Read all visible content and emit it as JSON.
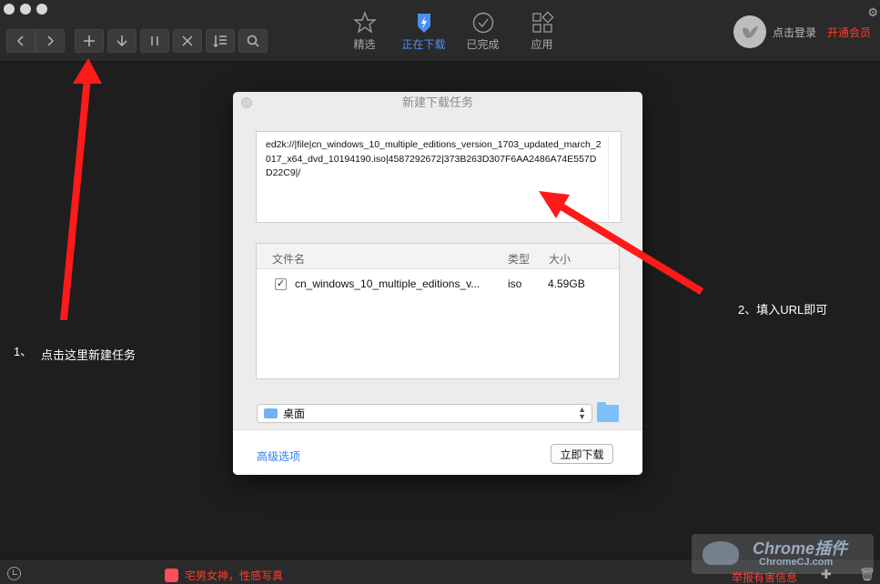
{
  "toolbar": {
    "tabs": [
      {
        "label": "精选",
        "icon": "star-icon"
      },
      {
        "label": "正在下载",
        "icon": "download-bolt-icon",
        "active": true
      },
      {
        "label": "已完成",
        "icon": "check-circle-icon"
      },
      {
        "label": "应用",
        "icon": "apps-icon"
      }
    ],
    "login": "点击登录",
    "vip": "开通会员"
  },
  "annotations": {
    "step1_num": "1、",
    "step1_text": "点击这里新建任务",
    "step2_text": "2、填入URL即可"
  },
  "dialog": {
    "title": "新建下载任务",
    "url_value": "ed2k://|file|cn_windows_10_multiple_editions_version_1703_updated_march_2017_x64_dvd_10194190.iso|4587292672|373B263D307F6AA2486A74E557DD22C9|/",
    "columns": {
      "name": "文件名",
      "type": "类型",
      "size": "大小"
    },
    "file": {
      "name": "cn_windows_10_multiple_editions_v...",
      "type": "iso",
      "size": "4.59GB",
      "checked": true
    },
    "save_path": "桌面",
    "advanced": "高级选项",
    "download_button": "立即下载"
  },
  "bottom": {
    "promo": "宅男女神，性感写真",
    "report": "举报有害信息"
  },
  "watermark": {
    "title": "Chrome插件",
    "sub": "ChromeCJ.com"
  },
  "colors": {
    "accent": "#4d8df7",
    "alert": "#ff3b30",
    "arrow": "#ff1a1a"
  }
}
